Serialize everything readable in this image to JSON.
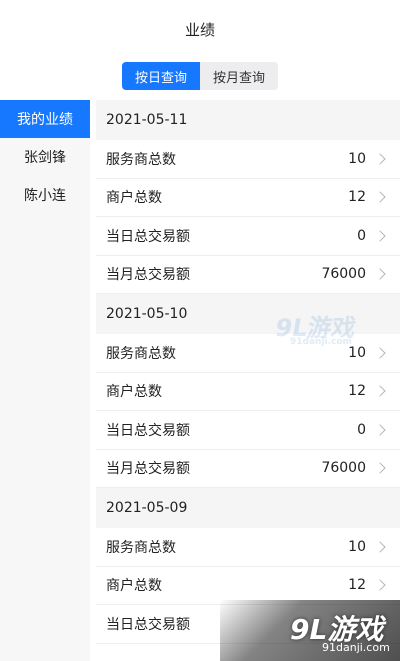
{
  "header": {
    "title": "业绩"
  },
  "tabs": [
    {
      "label": "按日查询",
      "active": true
    },
    {
      "label": "按月查询",
      "active": false
    }
  ],
  "sidebar": {
    "items": [
      {
        "label": "我的业绩",
        "active": true
      },
      {
        "label": "张剑锋",
        "active": false
      },
      {
        "label": "陈小连",
        "active": false
      }
    ]
  },
  "groups": [
    {
      "date": "2021-05-11",
      "rows": [
        {
          "label": "服务商总数",
          "value": "10"
        },
        {
          "label": "商户总数",
          "value": "12"
        },
        {
          "label": "当日总交易额",
          "value": "0"
        },
        {
          "label": "当月总交易额",
          "value": "76000"
        }
      ]
    },
    {
      "date": "2021-05-10",
      "rows": [
        {
          "label": "服务商总数",
          "value": "10"
        },
        {
          "label": "商户总数",
          "value": "12"
        },
        {
          "label": "当日总交易额",
          "value": "0"
        },
        {
          "label": "当月总交易额",
          "value": "76000"
        }
      ]
    },
    {
      "date": "2021-05-09",
      "rows": [
        {
          "label": "服务商总数",
          "value": "10"
        },
        {
          "label": "商户总数",
          "value": "12"
        },
        {
          "label": "当日总交易额",
          "value": ""
        }
      ]
    }
  ],
  "watermark": {
    "logo": "9L游戏",
    "sub": "91danji.com"
  },
  "colors": {
    "accent": "#1677ff",
    "sidebar_bg": "#f7f7f7",
    "section_bg": "#f5f5f5"
  }
}
